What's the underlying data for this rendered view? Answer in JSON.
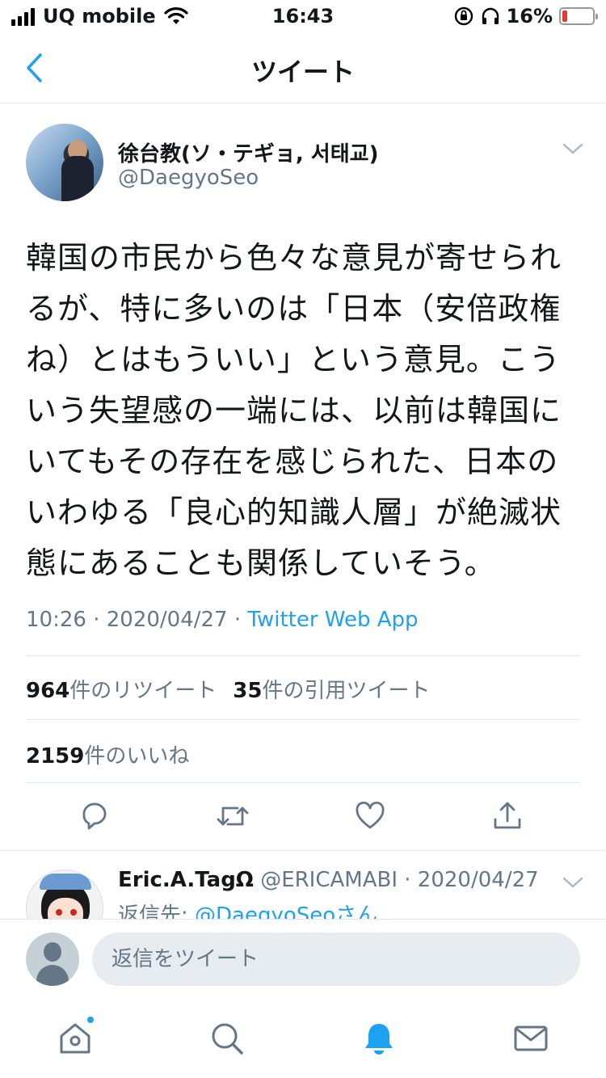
{
  "status_bar": {
    "carrier": "UQ mobile",
    "time": "16:43",
    "battery_percent": "16%",
    "battery_level": 0.16
  },
  "nav": {
    "title": "ツイート"
  },
  "tweet": {
    "author_name": "徐台教(ソ・テギョ, 서태교)",
    "author_handle": "@DaegyoSeo",
    "text": "韓国の市民から色々な意見が寄せられるが、特に多いのは「日本（安倍政権ね）とはもういい」という意見。こういう失望感の一端には、以前は韓国にいてもその存在を感じられた、日本のいわゆる「良心的知識人層」が絶滅状態にあることも関係していそう。",
    "time": "10:26",
    "date": "2020/04/27",
    "separator": "·",
    "source": "Twitter Web App",
    "retweets_count": "964",
    "retweets_label": "件のリツイート",
    "quotes_count": "35",
    "quotes_label": "件の引用ツイート",
    "likes_count": "2159",
    "likes_label": "件のいいね"
  },
  "reply": {
    "name": "Eric.A.TagΩ",
    "meta": "@ERICAMABI · 2020/04/27",
    "reply_to_label": "返信先: ",
    "reply_to_mention": "@DaegyoSeoさん"
  },
  "composer": {
    "placeholder": "返信をツイート"
  },
  "icons": {
    "back": "chevron-left-icon",
    "caret": "chevron-down-icon",
    "reply": "reply-icon",
    "retweet": "retweet-icon",
    "like": "heart-icon",
    "share": "share-icon",
    "home": "home-icon",
    "search": "search-icon",
    "notifications": "bell-icon",
    "messages": "mail-icon"
  },
  "colors": {
    "accent": "#1da1f2",
    "secondary_text": "#657786",
    "divider": "#e1e8ed"
  }
}
